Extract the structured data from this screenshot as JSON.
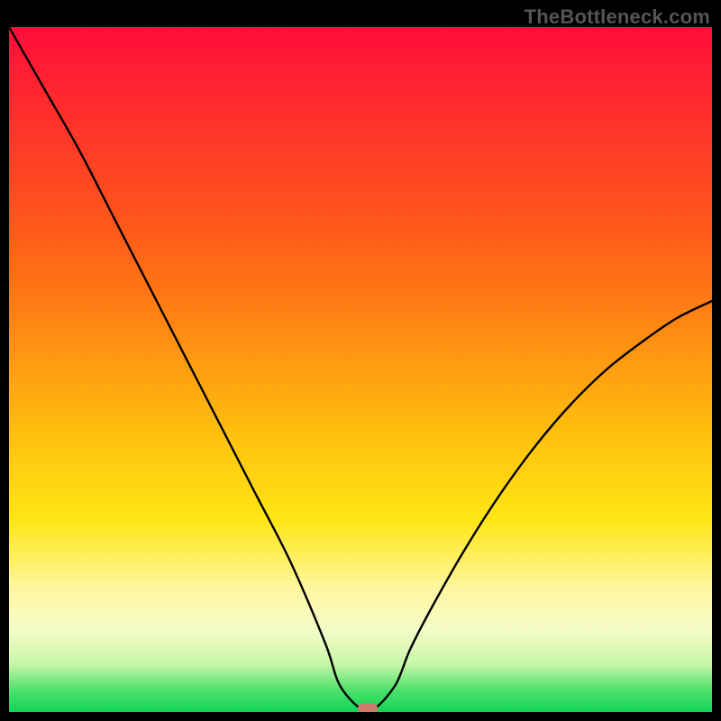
{
  "watermark": "TheBottleneck.com",
  "chart_data": {
    "type": "line",
    "title": "",
    "xlabel": "",
    "ylabel": "",
    "xlim": [
      0,
      100
    ],
    "ylim": [
      0,
      100
    ],
    "grid": false,
    "legend": false,
    "annotations": [],
    "background_gradient": {
      "orientation": "vertical",
      "stops": [
        {
          "pos": 0.0,
          "color": "#ff0d3a"
        },
        {
          "pos": 0.12,
          "color": "#ff2d2d"
        },
        {
          "pos": 0.3,
          "color": "#ff5a1a"
        },
        {
          "pos": 0.45,
          "color": "#ff8c12"
        },
        {
          "pos": 0.6,
          "color": "#ffc20e"
        },
        {
          "pos": 0.72,
          "color": "#ffe615"
        },
        {
          "pos": 0.82,
          "color": "#fff7a0"
        },
        {
          "pos": 0.88,
          "color": "#f6fcc8"
        },
        {
          "pos": 0.93,
          "color": "#c8f7a8"
        },
        {
          "pos": 0.97,
          "color": "#49e06b"
        },
        {
          "pos": 1.0,
          "color": "#11d455"
        }
      ]
    },
    "series": [
      {
        "name": "bottleneck-curve",
        "color": "#000000",
        "x": [
          0.0,
          5.0,
          10.0,
          15.0,
          20.0,
          25.0,
          30.0,
          35.0,
          40.0,
          45.0,
          47.0,
          50.0,
          52.0,
          55.0,
          57.0,
          60.0,
          65.0,
          70.0,
          75.0,
          80.0,
          85.0,
          90.0,
          95.0,
          100.0
        ],
        "values": [
          100.0,
          91.0,
          82.0,
          72.0,
          62.0,
          52.0,
          42.0,
          32.0,
          22.0,
          10.0,
          4.0,
          0.5,
          0.5,
          4.0,
          9.0,
          15.0,
          24.0,
          32.0,
          39.0,
          45.0,
          50.0,
          54.0,
          57.5,
          60.0
        ]
      }
    ],
    "marker": {
      "name": "optimal-point",
      "x": 51.0,
      "y": 0.5,
      "color": "#cc7a6e",
      "shape": "pill"
    }
  }
}
